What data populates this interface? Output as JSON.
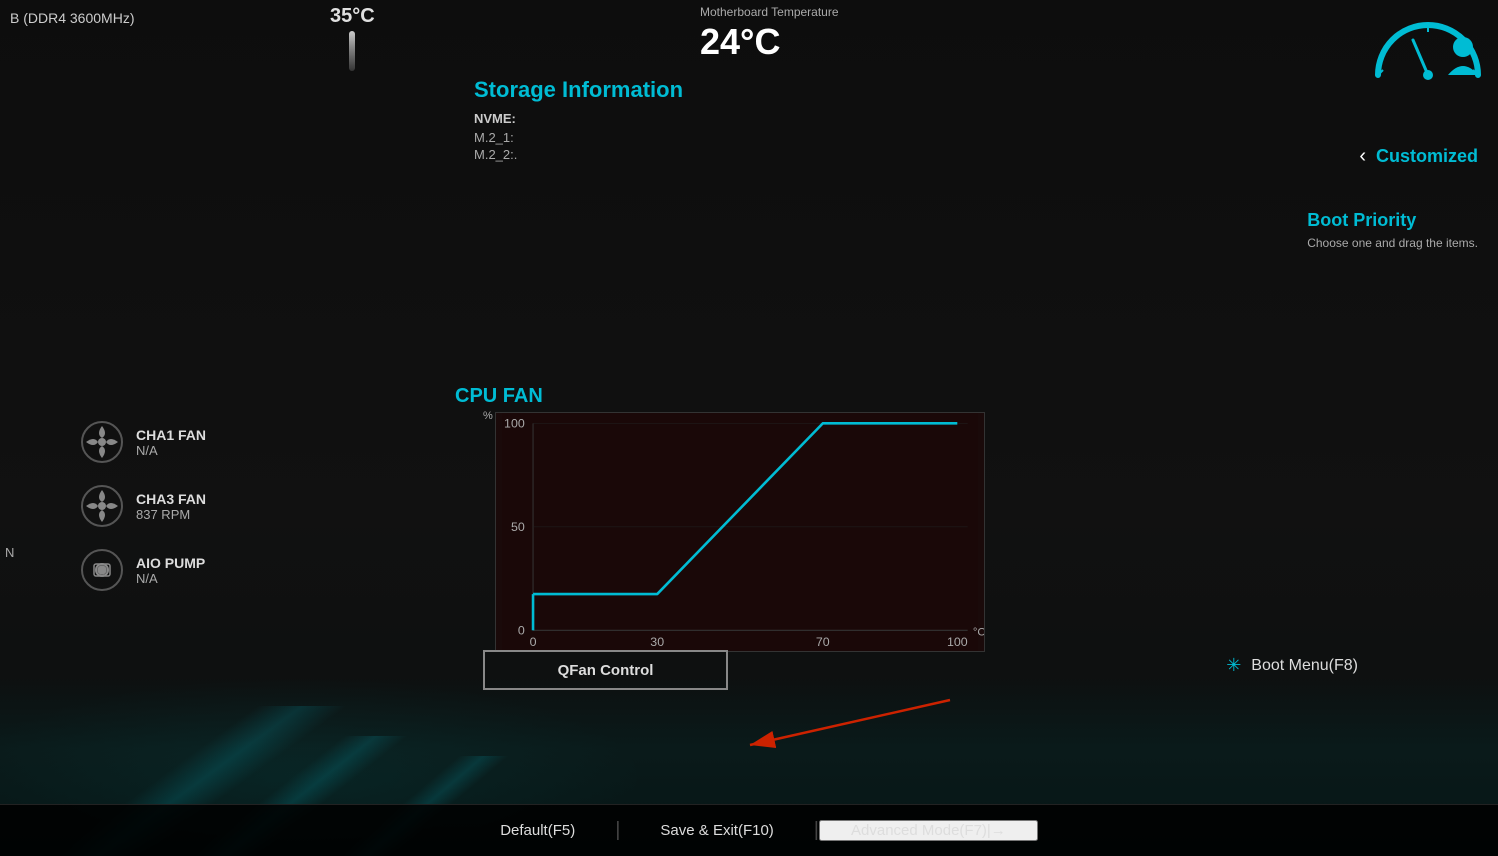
{
  "memory": {
    "label": "B (DDR4 3600MHz)"
  },
  "cpu_temp": {
    "value": "35°C"
  },
  "mb_temp": {
    "label": "Motherboard Temperature",
    "value": "24°C"
  },
  "storage": {
    "title": "Storage Information",
    "nvme_label": "NVME:",
    "m2_1_label": "M.2_1:",
    "m2_2_label": "M.2_2:."
  },
  "customized": {
    "label": "Customized",
    "chevron": "‹"
  },
  "boot_priority": {
    "title": "Boot Priority",
    "description": "Choose one and drag the items."
  },
  "fans": [
    {
      "name": "CHA1 FAN",
      "speed": "N/A"
    },
    {
      "name": "CHA3 FAN",
      "speed": "837 RPM"
    },
    {
      "name": "AIO PUMP",
      "speed": "N/A"
    }
  ],
  "cpu_fan": {
    "title": "CPU FAN",
    "y_label": "%",
    "x_label": "°C",
    "y_values": [
      "100",
      "50",
      "0"
    ],
    "x_values": [
      "0",
      "30",
      "70",
      "100"
    ]
  },
  "qfan_button": {
    "label": "QFan Control"
  },
  "boot_menu": {
    "label": "Boot Menu(F8)"
  },
  "bottom_bar": {
    "default": "Default(F5)",
    "save_exit": "Save & Exit(F10)",
    "advanced_mode": "Advanced Mode(F7)|→"
  },
  "left_label": "N"
}
